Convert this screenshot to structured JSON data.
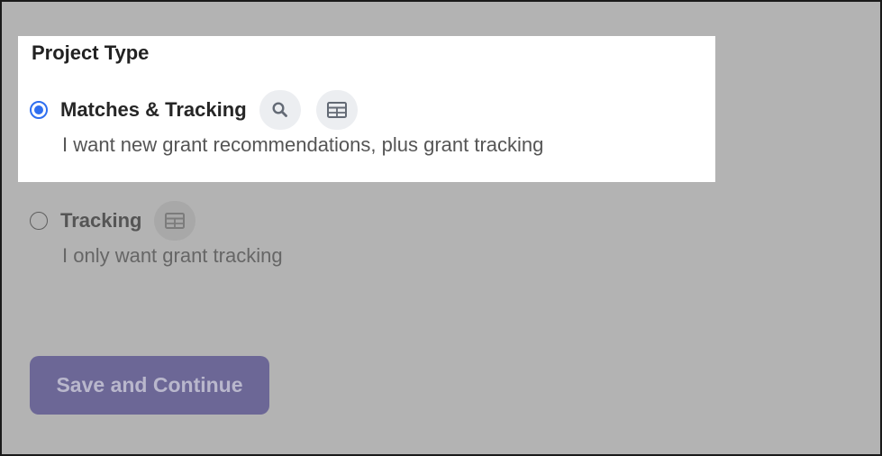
{
  "project_type": {
    "title": "Project Type",
    "options": [
      {
        "label": "Matches & Tracking",
        "description": "I want new grant recommendations, plus grant tracking",
        "selected": true,
        "icons": [
          "search-icon",
          "table-icon"
        ]
      },
      {
        "label": "Tracking",
        "description": "I only want grant tracking",
        "selected": false,
        "icons": [
          "table-icon"
        ]
      }
    ]
  },
  "actions": {
    "save_label": "Save and Continue"
  },
  "colors": {
    "overlay": "#b3b3b3",
    "radio_selected": "#2f6ff0",
    "button": "#6c6796",
    "button_text": "#b9b7cc"
  }
}
